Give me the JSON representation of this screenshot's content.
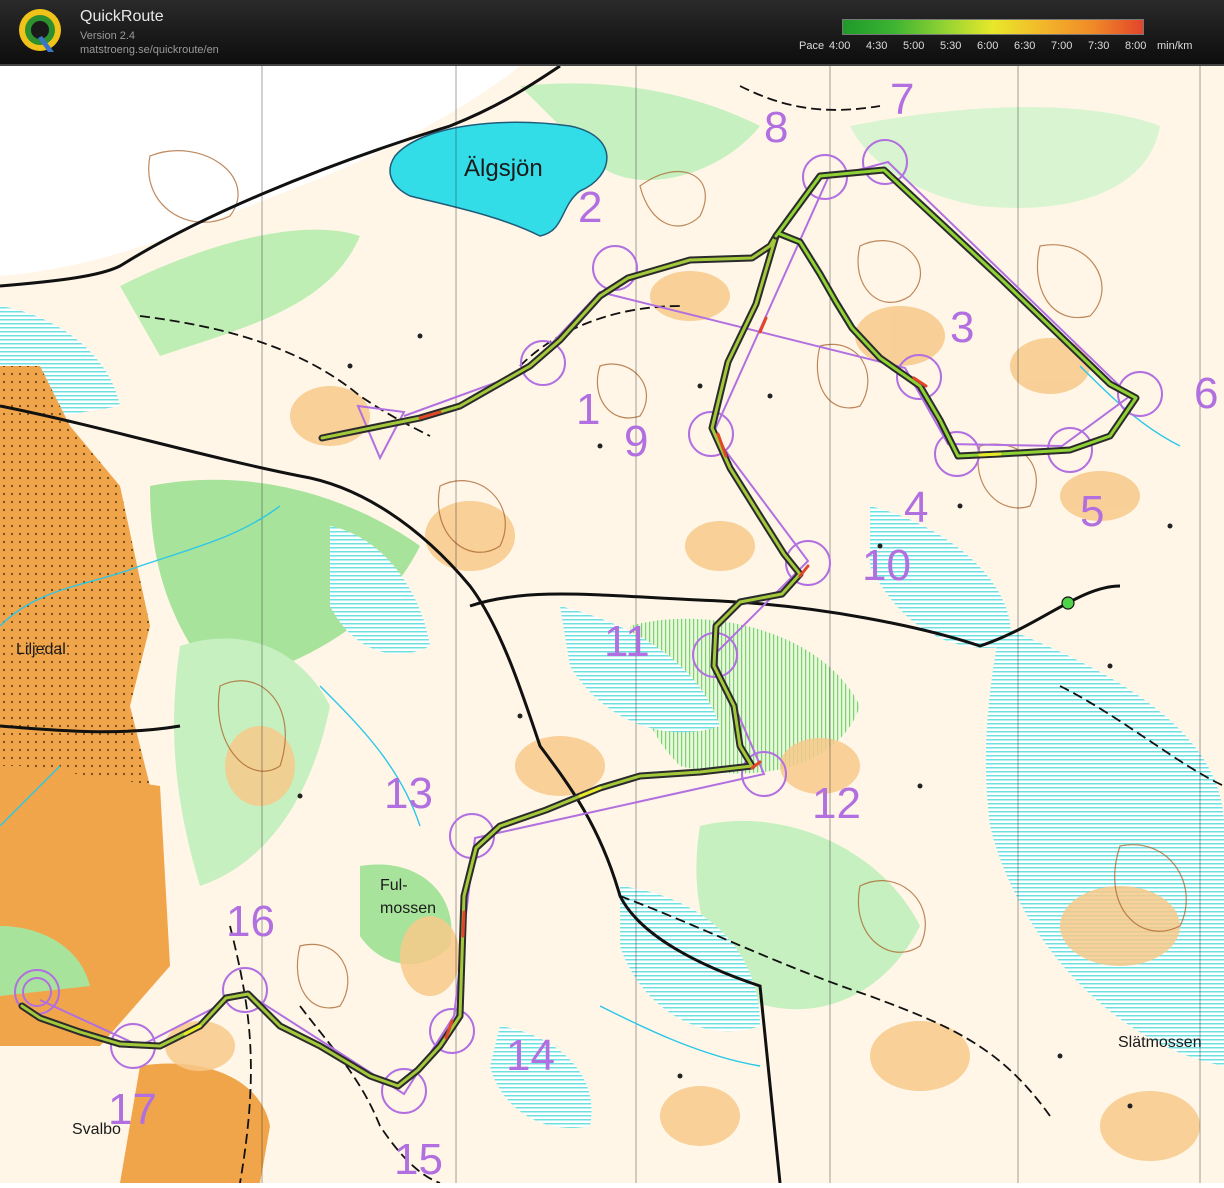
{
  "app": {
    "name": "QuickRoute",
    "version": "Version 2.4",
    "url": "matstroeng.se/quickroute/en"
  },
  "pace_legend": {
    "prefix": "Pace",
    "ticks": [
      "4:00",
      "4:30",
      "5:00",
      "5:30",
      "6:00",
      "6:30",
      "7:00",
      "7:30",
      "8:00"
    ],
    "unit": "min/km",
    "gradient_colors": [
      "#1f9a2a",
      "#3cb332",
      "#8fd233",
      "#e8e82a",
      "#f3b72a",
      "#f08a28",
      "#e2452a"
    ]
  },
  "map": {
    "labels": {
      "lake": "Älgsjön",
      "village_1": "Liljedal",
      "village_2": "Svalbo",
      "marsh_1_line1": "Ful-",
      "marsh_1_line2": "mossen",
      "marsh_2": "Slätmossen"
    },
    "controls": [
      "1",
      "2",
      "3",
      "4",
      "5",
      "6",
      "7",
      "8",
      "9",
      "10",
      "11",
      "12",
      "13",
      "14",
      "15",
      "16",
      "17"
    ],
    "colors": {
      "course": "#b16fe0",
      "route_outline": "#2b2b2b",
      "route_pace": "#a3c93a",
      "open_land": "#f7c98a",
      "forest_green": "#a7e39b",
      "marsh_cyan": "#6ee0e0",
      "water": "#32dde8",
      "settlement": "#f1a54a",
      "contour": "#a8612a"
    }
  }
}
